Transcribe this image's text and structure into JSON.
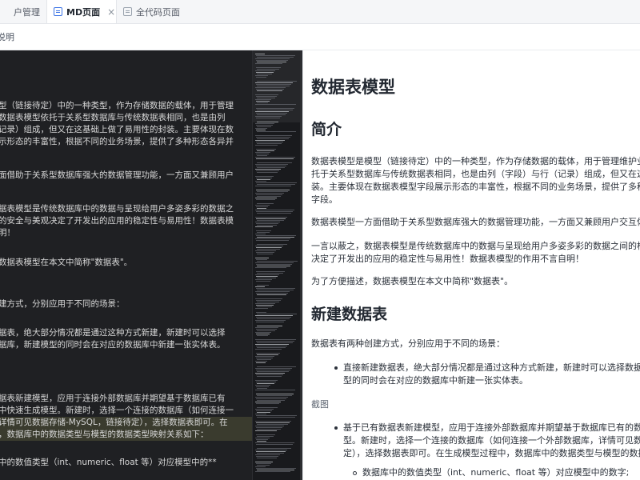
{
  "tabs": [
    {
      "label": "户管理"
    },
    {
      "label": "MD页面",
      "close": "×"
    },
    {
      "label": "全代码页面"
    }
  ],
  "subbar": {
    "label": "说明"
  },
  "editor_lines": [
    "型（链接待定）中的一种类型，作为存储数据的载体，用于管理",
    "数据表模型依托于关系型数据库与传统数据表相同，也是由列",
    "记录）组成，但又在这基础上做了易用性的封装。主要体现在数",
    "示形态的丰富性，根据不同的业务场景，提供了多种形态各异并",
    "",
    "面借助于关系型数据库强大的数据管理功能，一方面又兼顾用户",
    "",
    "据表模型是传统数据库中的数据与呈现给用户多姿多彩的数据之",
    "的安全与美观决定了开发出的应用的稳定性与易用性！数据表模",
    "明！",
    "",
    "数据表模型在本文中简称\"数据表\"。",
    "",
    "",
    "建方式，分别应用于不同的场景：",
    "",
    "据表，绝大部分情况都是通过这种方式新建，新建时可以选择",
    "据库，新建模型的同时会在对应的数据库中新建一张实体表。",
    "",
    "",
    "",
    "据表新建模型，应用于连接外部数据库并期望基于数据库已有",
    "中快速生成模型。新建时，选择一个连接的数据库（如何连接一",
    "详情可见数据存储-MySQL，链接待定），选择数据表即可。在",
    "，数据库中的数据类型与模型的数据类型映射关系如下：",
    "",
    "中的数值类型（int、numeric、float 等）对应模型中的**"
  ],
  "preview": {
    "h1": "数据表模型",
    "h2_intro": "简介",
    "intro_lines": [
      "数据表模型是模型（链接待定）中的一种类型，作为存储数据的载体，用于管理维护业",
      "托于关系型数据库与传统数据表相同，也是由列（字段）与行（记录）组成，但又在这",
      "装。主要体现在数据表模型字段展示形态的丰富性，根据不同的业务场景，提供了多种",
      "字段。"
    ],
    "para2": "数据表模型一方面借助于关系型数据库强大的数据管理功能，一方面又兼顾用户交互体",
    "para3_lines": [
      "一言以蔽之，数据表模型是传统数据库中的数据与呈现给用户多姿多彩的数据之间的桥",
      "决定了开发出的应用的稳定性与易用性！数据表模型的作用不言自明！"
    ],
    "para4": "为了方便描述，数据表模型在本文中简称\"数据表\"。",
    "h2_new": "新建数据表",
    "para5": "数据表有两种创建方式，分别应用于不同的场景：",
    "bullet1_lines": [
      "直接新建数据表，绝大部分情况都是通过这种方式新建，新建时可以选择数据表",
      "型的同时会在对应的数据库中新建一张实体表。"
    ],
    "screenshot_label": "截图",
    "bullet2_lines": [
      "基于已有数据表新建模型，应用于连接外部数据库并期望基于数据库已有的数据",
      "型。新建时，选择一个连接的数据库（如何连接一个外部数据库，详情可见数",
      "定），选择数据表即可。在生成模型过程中，数据库中的数据类型与模型的数据"
    ],
    "sub_bullet": "数据库中的数值类型（int、numeric、float 等）对应模型中的数字;"
  },
  "colors": {
    "editor_bg": "#1f2023",
    "active_tab_icon": "#3b73e6",
    "text": "#2b313a"
  }
}
